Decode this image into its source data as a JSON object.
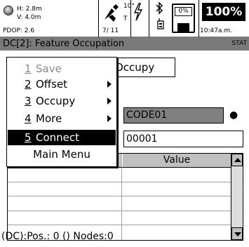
{
  "status_bar": {
    "h_accuracy": "H: 2.8m",
    "v_accuracy": "V: 4.0m",
    "pdop": "PDOP: 2.6",
    "sat_elevation": "10°",
    "sat_type": "T",
    "sat_count": "7/ 11",
    "card_percent": "0%",
    "battery": "100%",
    "time": "10:47a.m.",
    "icons": [
      "gps-indicator-icon",
      "satellite-icon",
      "power-bolt-icon",
      "bluetooth-icon",
      "radio-icon",
      "memory-card-icon"
    ]
  },
  "title_bar": {
    "title": "DC[2]: Feature Occupation",
    "stat_label": "STAT"
  },
  "form": {
    "occupy_button": "Occupy",
    "code_value": "CODE01",
    "bullet": "●",
    "number_value": "00001"
  },
  "table": {
    "columns": [
      "",
      "Value"
    ],
    "rows": [
      [
        "",
        ""
      ],
      [
        "",
        ""
      ],
      [
        "",
        ""
      ],
      [
        "",
        ""
      ],
      [
        "",
        ""
      ]
    ]
  },
  "menu": {
    "items": [
      {
        "num": "1",
        "label": "Save",
        "state": "disabled",
        "submenu": false
      },
      {
        "num": "2",
        "label": "Offset",
        "state": "normal",
        "submenu": true
      },
      {
        "num": "3",
        "label": "Occupy",
        "state": "normal",
        "submenu": true
      },
      {
        "num": "4",
        "label": "More",
        "state": "normal",
        "submenu": true
      },
      {
        "num": "5",
        "label": "Connect",
        "state": "selected",
        "submenu": false
      }
    ],
    "main_menu_label": "Main Menu"
  },
  "footer": {
    "status": "(DC):Pos.: 0 () Nodes:0"
  }
}
